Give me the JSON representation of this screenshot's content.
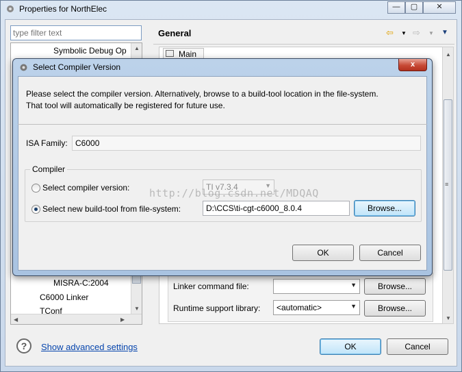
{
  "outer_window": {
    "title": "Properties for NorthElec",
    "controls": {
      "minimize": "—",
      "maximize": "▢",
      "close": "✕"
    }
  },
  "filter": {
    "placeholder": "type filter text"
  },
  "tree": {
    "items": [
      {
        "label": "Symbolic Debug Op",
        "indent": 3
      },
      {
        "label": "MISRA-C:2004",
        "indent": 3
      },
      {
        "label": "C6000 Linker",
        "indent": 2
      },
      {
        "label": "TConf",
        "indent": 2
      }
    ]
  },
  "page": {
    "title": "General",
    "tab_main": "Main",
    "linker_cmd_label": "Linker command file:",
    "linker_cmd_value": "",
    "runtime_lib_label": "Runtime support library:",
    "runtime_lib_value": "<automatic>",
    "browse1": "Browse...",
    "browse2": "Browse..."
  },
  "bottom": {
    "advanced_link": "Show advanced settings",
    "ok": "OK",
    "cancel": "Cancel"
  },
  "dialog": {
    "title": "Select Compiler Version",
    "close": "x",
    "message_line1": "Please select the compiler version. Alternatively, browse to a build-tool location in the file-system.",
    "message_line2": "That tool will automatically be registered for future use.",
    "isa_label": "ISA Family:",
    "isa_value": "C6000",
    "group_label": "Compiler",
    "radio_version_label": "Select compiler version:",
    "version_value": "TI v7.3.4",
    "radio_new_label": "Select new build-tool from file-system:",
    "path_value": "D:\\CCS\\ti-cgt-c6000_8.0.4",
    "browse": "Browse...",
    "ok": "OK",
    "cancel": "Cancel",
    "selected_option": "new_build_tool"
  },
  "watermark": "http://blog.csdn.net/MDQAQ",
  "colors": {
    "link": "#0645ad",
    "dialog_frame": "#a9c3e1",
    "close_red": "#c74a36"
  }
}
